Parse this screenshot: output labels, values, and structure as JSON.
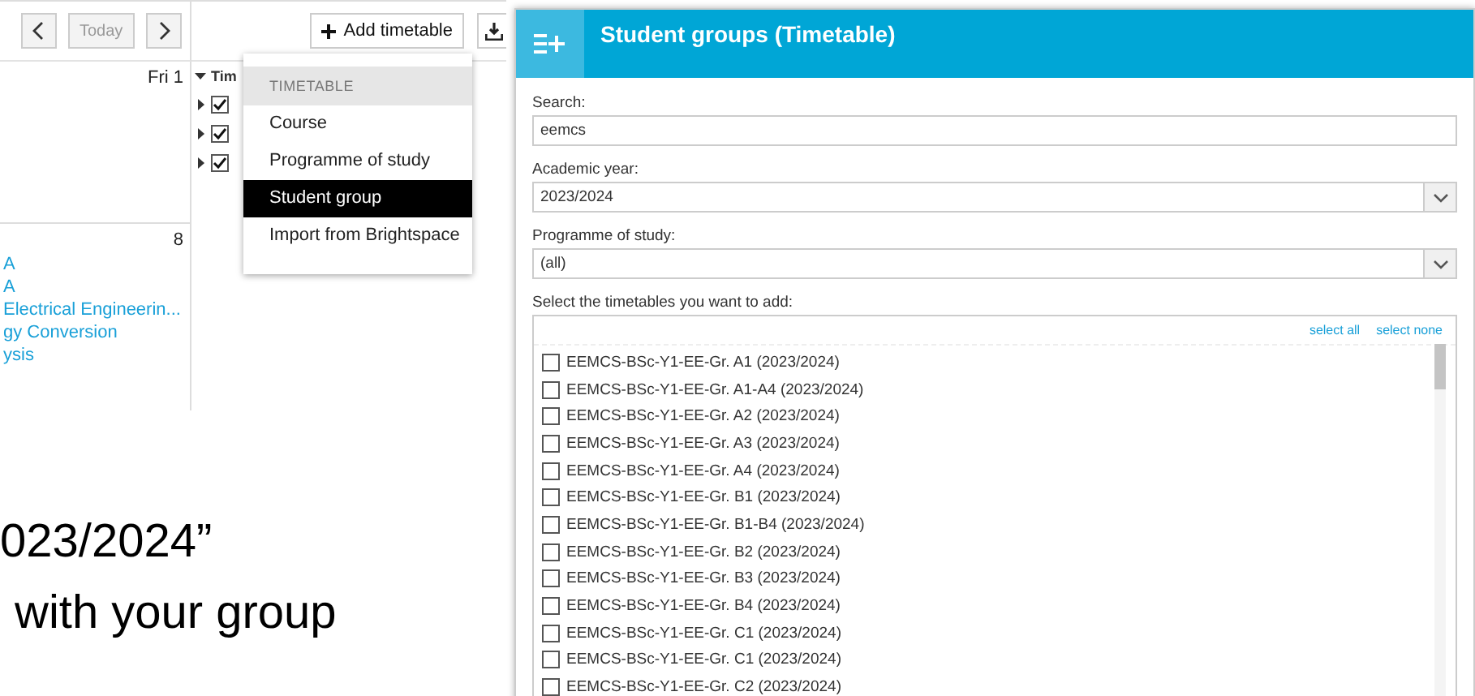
{
  "calendar": {
    "today_button": "Today",
    "add_timetable_button": "Add timetable",
    "day_labels": [
      "Fri 1",
      "8"
    ],
    "tree_header": "Tim",
    "tree_rows": [
      {
        "checked": true
      },
      {
        "checked": true
      },
      {
        "checked": true
      }
    ],
    "events": [
      "A",
      "A",
      "Electrical Engineerin...",
      "gy Conversion",
      "ysis"
    ],
    "menu": {
      "header": "TIMETABLE",
      "items": [
        {
          "label": "Course",
          "selected": false
        },
        {
          "label": "Programme of study",
          "selected": false
        },
        {
          "label": "Student group",
          "selected": true
        },
        {
          "label": "Import from Brightspace",
          "selected": false
        }
      ]
    }
  },
  "dialog": {
    "title": "Student groups (Timetable)",
    "search": {
      "label": "Search:",
      "value": "eemcs"
    },
    "academic_year": {
      "label": "Academic year:",
      "value": "2023/2024"
    },
    "programme": {
      "label": "Programme of study:",
      "value": "(all)"
    },
    "list_label": "Select the timetables you want to add:",
    "links": [
      "select all",
      "select none"
    ],
    "items": [
      {
        "label": "EEMCS-BSc-Y1-EE-Gr. A1 (2023/2024)",
        "checked": false
      },
      {
        "label": "EEMCS-BSc-Y1-EE-Gr. A1-A4 (2023/2024)",
        "checked": false
      },
      {
        "label": "EEMCS-BSc-Y1-EE-Gr. A2 (2023/2024)",
        "checked": false
      },
      {
        "label": "EEMCS-BSc-Y1-EE-Gr. A3 (2023/2024)",
        "checked": false
      },
      {
        "label": "EEMCS-BSc-Y1-EE-Gr. A4 (2023/2024)",
        "checked": false
      },
      {
        "label": "EEMCS-BSc-Y1-EE-Gr. B1 (2023/2024)",
        "checked": false
      },
      {
        "label": "EEMCS-BSc-Y1-EE-Gr. B1-B4 (2023/2024)",
        "checked": false
      },
      {
        "label": "EEMCS-BSc-Y1-EE-Gr. B2 (2023/2024)",
        "checked": false
      },
      {
        "label": "EEMCS-BSc-Y1-EE-Gr. B3 (2023/2024)",
        "checked": false
      },
      {
        "label": "EEMCS-BSc-Y1-EE-Gr. B4 (2023/2024)",
        "checked": false
      },
      {
        "label": "EEMCS-BSc-Y1-EE-Gr. C1 (2023/2024)",
        "checked": false
      },
      {
        "label": "EEMCS-BSc-Y1-EE-Gr. C1 (2023/2024)",
        "checked": false
      },
      {
        "label": "EEMCS-BSc-Y1-EE-Gr. C2 (2023/2024)",
        "checked": false
      }
    ]
  },
  "slide_text": [
    "023/2024”",
    "with your group"
  ]
}
